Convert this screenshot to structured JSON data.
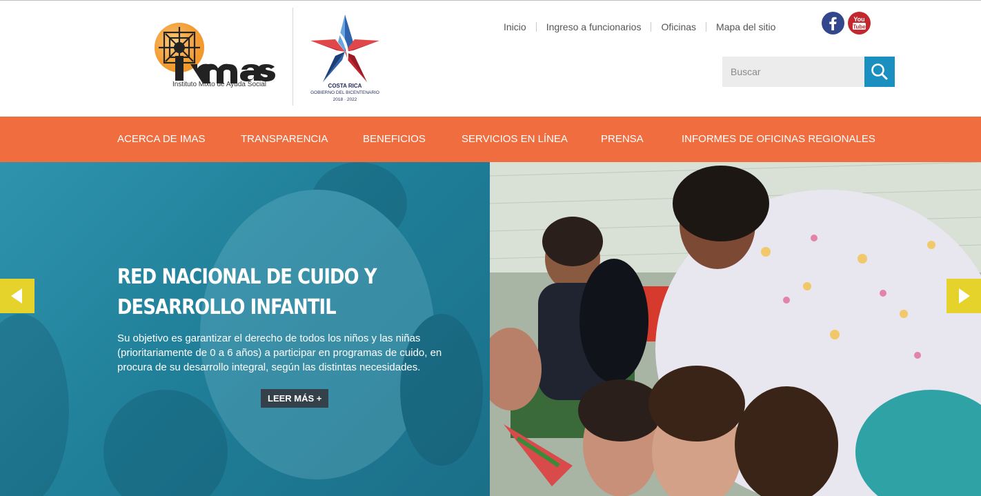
{
  "header": {
    "logo": {
      "org_name": "imas",
      "org_full_name": "Instituto Mixto de Ayuda Social"
    },
    "gov_logo": {
      "country": "COSTA RICA",
      "line1": "GOBIERNO DEL BICENTENARIO",
      "line2": "2018 · 2022"
    },
    "top_links": [
      "Inicio",
      "Ingreso a funcionarios",
      "Oficinas",
      "Mapa del sitio"
    ],
    "social": [
      {
        "icon": "facebook-icon",
        "color": "#34478d"
      },
      {
        "icon": "youtube-icon",
        "color": "#c1272d",
        "label_top": "You",
        "label_bottom": "Tube"
      }
    ],
    "search": {
      "placeholder": "Buscar",
      "icon": "search-icon",
      "button_color": "#1b8fc0"
    }
  },
  "nav": {
    "color": "#ef6d3f",
    "items": [
      "ACERCA DE IMAS",
      "TRANSPARENCIA",
      "BENEFICIOS",
      "SERVICIOS EN LÍNEA",
      "PRENSA",
      "INFORMES DE OFICINAS REGIONALES"
    ]
  },
  "slider": {
    "title": "RED NACIONAL DE CUIDO Y DESARROLLO INFANTIL",
    "text": "Su objetivo es garantizar el derecho de todos los niños y las niñas (prioritariamente de 0 a 6 años) a participar en programas de cuido, en procura de su desarrollo integral, según las distintas necesidades.",
    "button": "LEER MÁS +",
    "prev_icon": "arrow-left-icon",
    "next_icon": "arrow-right-icon",
    "arrow_color": "#e5d22a"
  }
}
